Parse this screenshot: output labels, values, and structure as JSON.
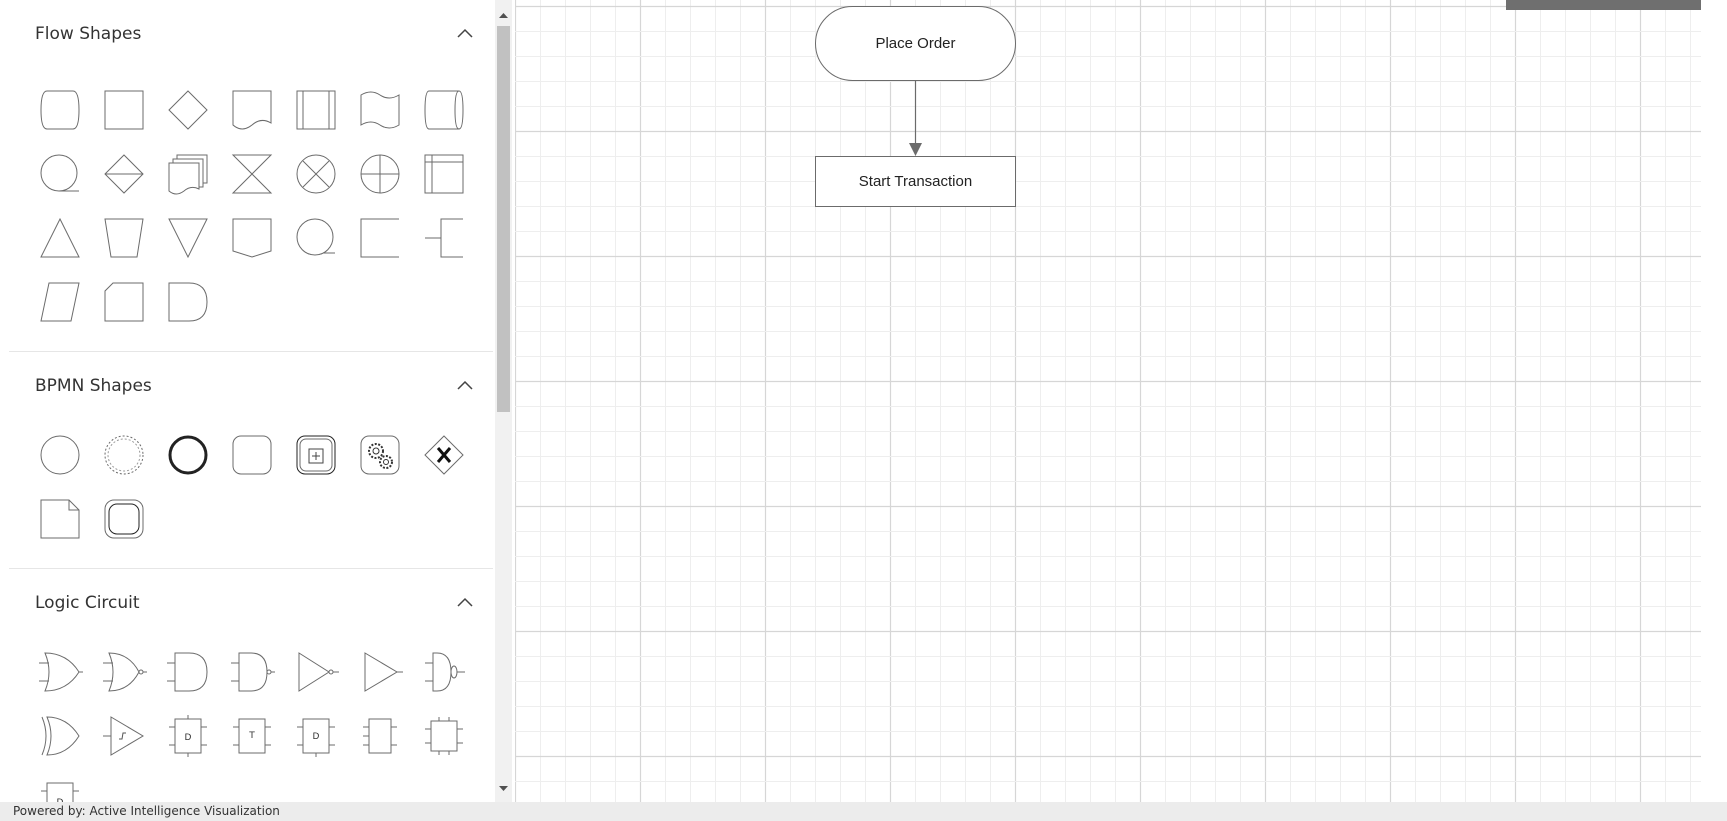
{
  "palette": {
    "sections": [
      {
        "title": "Flow Shapes",
        "shapes": [
          "Terminator",
          "Process",
          "Decision",
          "Document",
          "PreDefinedProcess",
          "PaperTap",
          "DirectData",
          "SequentialData",
          "Sort",
          "MultiDocument",
          "Collate",
          "SummingJunction",
          "Or",
          "InternalStorage",
          "Extract",
          "ManualOperation",
          "Merge",
          "OffPageReference",
          "SequentialAccessStorage",
          "Annotation",
          "Annotation2",
          "Data",
          "Card",
          "Delay"
        ]
      },
      {
        "title": "BPMN Shapes",
        "shapes": [
          "Event",
          "NonInterruptingEvent",
          "EndEvent",
          "Task",
          "CollapsedSubProcess",
          "ServiceTask",
          "ExclusiveGateway",
          "DataObject",
          "Transaction"
        ]
      },
      {
        "title": "Logic Circuit",
        "shapes": [
          "OrGate",
          "NorGate",
          "AndGate",
          "NandGate",
          "NotGate",
          "Buffer",
          "Nor2",
          "XorGate",
          "SchmittTrigger",
          "DFlipFlop",
          "TFlipFlop",
          "JKFlipFlop",
          "SRFlipFlop",
          "Counter",
          "Register"
        ]
      }
    ]
  },
  "diagram": {
    "nodes": [
      {
        "id": "place-order",
        "label": "Place Order",
        "shape": "terminator"
      },
      {
        "id": "start-transaction",
        "label": "Start Transaction",
        "shape": "process"
      }
    ],
    "connectors": [
      {
        "from": "place-order",
        "to": "start-transaction"
      }
    ]
  },
  "footer": {
    "text": "Powered by: Active Intelligence Visualization"
  },
  "colors": {
    "stroke": "#6b6b6b",
    "gridMajor": "#d6d6d6",
    "gridMinor": "#eeeeee",
    "toolbar": "#6f6f6f"
  }
}
